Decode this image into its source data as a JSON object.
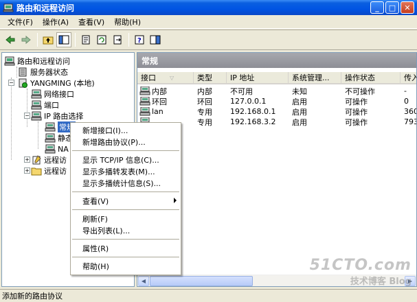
{
  "window": {
    "title": "路由和远程访问"
  },
  "menu": {
    "items": [
      "文件(F)",
      "操作(A)",
      "查看(V)",
      "帮助(H)"
    ]
  },
  "toolbar": {
    "icons": [
      "back-icon",
      "forward-icon",
      "up-icon",
      "show-hide-tree-icon",
      "properties-icon",
      "refresh-icon",
      "export-icon",
      "help-icon",
      "action-pane-icon"
    ]
  },
  "tree": {
    "root": "路由和远程访问",
    "server_status": "服务器状态",
    "server": "YANGMING (本地)",
    "network_interfaces": "网络接口",
    "ports": "端口",
    "ip_routing": "IP 路由选择",
    "general": "常规",
    "static": "静态",
    "nat": "NA",
    "remote1": "远程访",
    "remote2": "远程访"
  },
  "pane": {
    "title": "常规"
  },
  "table": {
    "columns": [
      "接口",
      "类型",
      "IP 地址",
      "系统管理...",
      "操作状态",
      "传入"
    ],
    "rows": [
      {
        "iface": "内部",
        "type": "内部",
        "ip": "不可用",
        "admin": "未知",
        "oper": "不可操作",
        "incoming": "-"
      },
      {
        "iface": "环回",
        "type": "环回",
        "ip": "127.0.0.1",
        "admin": "启用",
        "oper": "可操作",
        "incoming": "0"
      },
      {
        "iface": "lan",
        "type": "专用",
        "ip": "192.168.0.1",
        "admin": "启用",
        "oper": "可操作",
        "incoming": "360"
      },
      {
        "iface": "",
        "type": "专用",
        "ip": "192.168.3.2",
        "admin": "启用",
        "oper": "可操作",
        "incoming": "793"
      }
    ]
  },
  "context_menu": {
    "new_interface": "新增接口(I)...",
    "new_protocol": "新增路由协议(P)...",
    "show_tcpip": "显示 TCP/IP 信息(C)...",
    "show_mforward": "显示多播转发表(M)...",
    "show_mstats": "显示多播统计信息(S)...",
    "view": "查看(V)",
    "refresh": "刷新(F)",
    "export": "导出列表(L)...",
    "properties": "属性(R)",
    "help": "帮助(H)"
  },
  "status": {
    "text": "添加新的路由协议"
  },
  "watermark": {
    "big": "51CTO.com",
    "small": "技术博客  Blog"
  }
}
